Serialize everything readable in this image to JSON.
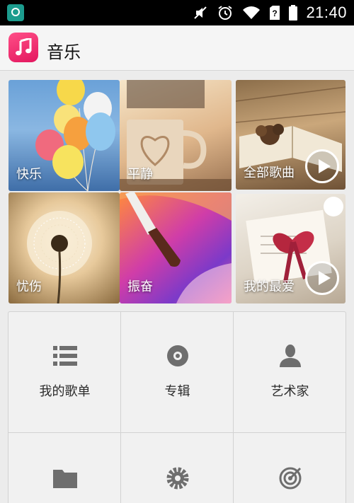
{
  "status_bar": {
    "time": "21:40",
    "icons": [
      "huawei-logo-icon",
      "mute-icon",
      "alarm-icon",
      "wifi-icon",
      "sim-unknown-icon",
      "battery-icon"
    ]
  },
  "app_bar": {
    "title": "音乐",
    "icon": "music-note-icon",
    "accent": "#e8246c"
  },
  "tiles": [
    {
      "label": "快乐"
    },
    {
      "label": "平静"
    },
    {
      "label": "全部歌曲",
      "play_button": true
    },
    {
      "label": "忧伤"
    },
    {
      "label": "振奋"
    },
    {
      "label": "我的最爱",
      "play_button": true
    }
  ],
  "categories": [
    {
      "label": "我的歌单",
      "icon": "playlist-icon"
    },
    {
      "label": "专辑",
      "icon": "disc-icon"
    },
    {
      "label": "艺术家",
      "icon": "artist-icon"
    },
    {
      "label": "",
      "icon": "folder-icon"
    },
    {
      "label": "",
      "icon": "settings-gear-icon"
    },
    {
      "label": "",
      "icon": "target-icon"
    }
  ]
}
